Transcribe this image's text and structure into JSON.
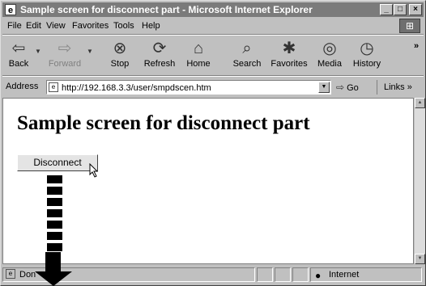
{
  "window": {
    "title": "Sample screen for disconnect part - Microsoft Internet Explorer",
    "title_icon": "ie-page-icon",
    "controls": [
      "minimize",
      "maximize",
      "close"
    ]
  },
  "menu": {
    "items": [
      "File",
      "Edit",
      "View",
      "Favorites",
      "Tools",
      "Help"
    ]
  },
  "toolbar": {
    "buttons": [
      {
        "label": "Back",
        "icon": "back-arrow",
        "enabled": true
      },
      {
        "label": "Forward",
        "icon": "forward-arrow",
        "enabled": false
      },
      {
        "label": "Stop",
        "icon": "stop-icon",
        "enabled": true
      },
      {
        "label": "Refresh",
        "icon": "refresh-icon",
        "enabled": true
      },
      {
        "label": "Home",
        "icon": "home-icon",
        "enabled": true
      },
      {
        "label": "Search",
        "icon": "search-icon",
        "enabled": true
      },
      {
        "label": "Favorites",
        "icon": "favorites-icon",
        "enabled": true
      },
      {
        "label": "Media",
        "icon": "media-icon",
        "enabled": true
      },
      {
        "label": "History",
        "icon": "history-icon",
        "enabled": true
      }
    ],
    "overflow": "»"
  },
  "address": {
    "label": "Address",
    "url": "http://192.168.3.3/user/smpdscen.htm",
    "go_label": "Go",
    "links_label": "Links »"
  },
  "page": {
    "heading": "Sample screen for disconnect part",
    "disconnect_button": "Disconnect"
  },
  "status": {
    "text": "Don",
    "zone": "Internet"
  }
}
